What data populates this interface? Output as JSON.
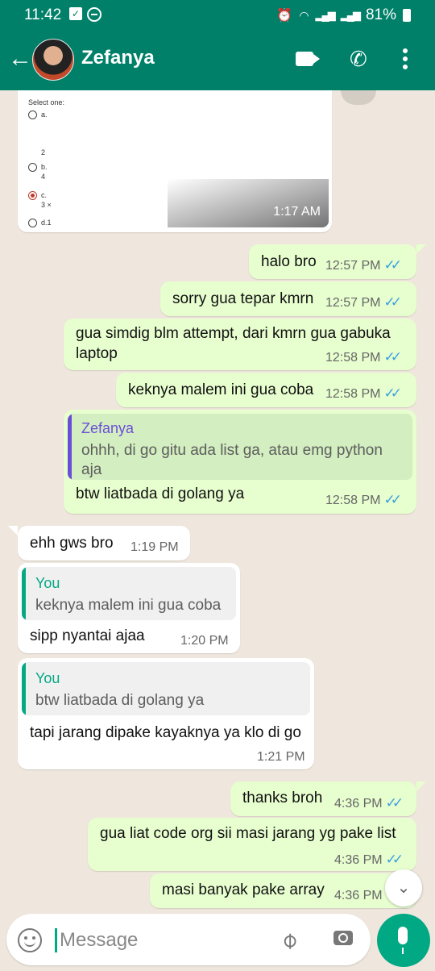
{
  "status_bar": {
    "time": "11:42",
    "battery": "81%"
  },
  "header": {
    "contact_name": "Zefanya"
  },
  "image_message": {
    "quiz_label": "Select one:",
    "options": [
      {
        "letter": "a.",
        "value": "",
        "selected": false
      },
      {
        "letter": "b.",
        "value": "4",
        "selected": false,
        "pre": "2"
      },
      {
        "letter": "c.",
        "value": "3 ×",
        "selected": true
      },
      {
        "letter": "d.1",
        "value": "",
        "selected": false
      }
    ],
    "time": "1:17 AM"
  },
  "messages": [
    {
      "dir": "out",
      "text": "halo bro",
      "time": "12:57 PM"
    },
    {
      "dir": "out",
      "text": "sorry gua tepar kmrn",
      "time": "12:57 PM"
    },
    {
      "dir": "out",
      "text": "gua simdig blm attempt, dari kmrn gua gabuka laptop",
      "time": "12:58 PM"
    },
    {
      "dir": "out",
      "text": "keknya malem ini gua coba",
      "time": "12:58 PM"
    },
    {
      "dir": "out",
      "quote_author": "Zefanya",
      "quote_text": "ohhh, di go gitu ada list ga, atau emg python aja",
      "text": "btw liatbada di golang ya",
      "time": "12:58 PM"
    },
    {
      "dir": "in",
      "text": "ehh gws bro",
      "time": "1:19 PM"
    },
    {
      "dir": "in",
      "quote_author": "You",
      "quote_text": "keknya malem ini gua coba",
      "text": "sipp nyantai ajaa",
      "time": "1:20 PM"
    },
    {
      "dir": "in",
      "quote_author": "You",
      "quote_text": "btw liatbada di golang ya",
      "text": "tapi jarang dipake kayaknya ya klo di go",
      "time": "1:21 PM"
    },
    {
      "dir": "out",
      "text": "thanks broh",
      "time": "4:36 PM"
    },
    {
      "dir": "out",
      "text": "gua liat code org sii masi jarang yg pake list",
      "time": "4:36 PM"
    },
    {
      "dir": "out",
      "text": "masi banyak pake array",
      "time": "4:36 PM"
    }
  ],
  "composer": {
    "placeholder": "Message"
  },
  "colors": {
    "header": "#008069",
    "outgoing_bubble": "#e7fecf",
    "incoming_bubble": "#ffffff",
    "accent": "#00a884",
    "read_ticks": "#39a1e0",
    "quote_bar_contact": "#6a4fd6",
    "quote_bar_you": "#06a884"
  }
}
